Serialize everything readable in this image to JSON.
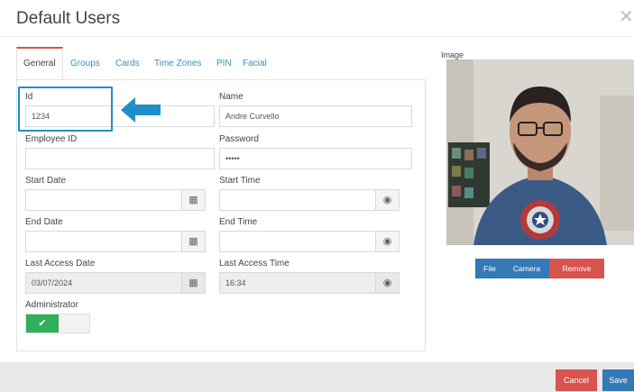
{
  "dialog": {
    "title": "Default Users"
  },
  "tabs": [
    {
      "label": "General"
    },
    {
      "label": "Groups"
    },
    {
      "label": "Cards"
    },
    {
      "label": "Time Zones"
    },
    {
      "label": "PIN"
    },
    {
      "label": "Facial"
    }
  ],
  "form": {
    "id": {
      "label": "Id",
      "value": "1234"
    },
    "name": {
      "label": "Name",
      "value": "Andre Curvello"
    },
    "employee_id": {
      "label": "Employee ID",
      "value": ""
    },
    "password": {
      "label": "Password",
      "value": "•••••"
    },
    "start_date": {
      "label": "Start Date",
      "value": ""
    },
    "start_time": {
      "label": "Start Time",
      "value": ""
    },
    "end_date": {
      "label": "End Date",
      "value": ""
    },
    "end_time": {
      "label": "End Time",
      "value": ""
    },
    "last_access_date": {
      "label": "Last Access Date",
      "value": "03/07/2024"
    },
    "last_access_time": {
      "label": "Last Access Time",
      "value": "16:34"
    },
    "administrator": {
      "label": "Administrator",
      "enabled": true
    }
  },
  "image_panel": {
    "label": "Image",
    "buttons": {
      "file": "File",
      "camera": "Camera",
      "remove": "Remove"
    }
  },
  "footer": {
    "cancel": "Cancel",
    "save": "Save"
  },
  "colors": {
    "link": "#3c8dbc",
    "active_tab_border": "#d9534f",
    "highlight": "#1f8ec9",
    "toggle_on": "#2fb05a",
    "primary": "#337ab7",
    "danger": "#d9534f"
  },
  "icons": {
    "close": "close-icon",
    "calendar": "calendar-icon",
    "clock": "clock-icon",
    "check": "check-icon",
    "arrow": "arrow-left-icon"
  }
}
